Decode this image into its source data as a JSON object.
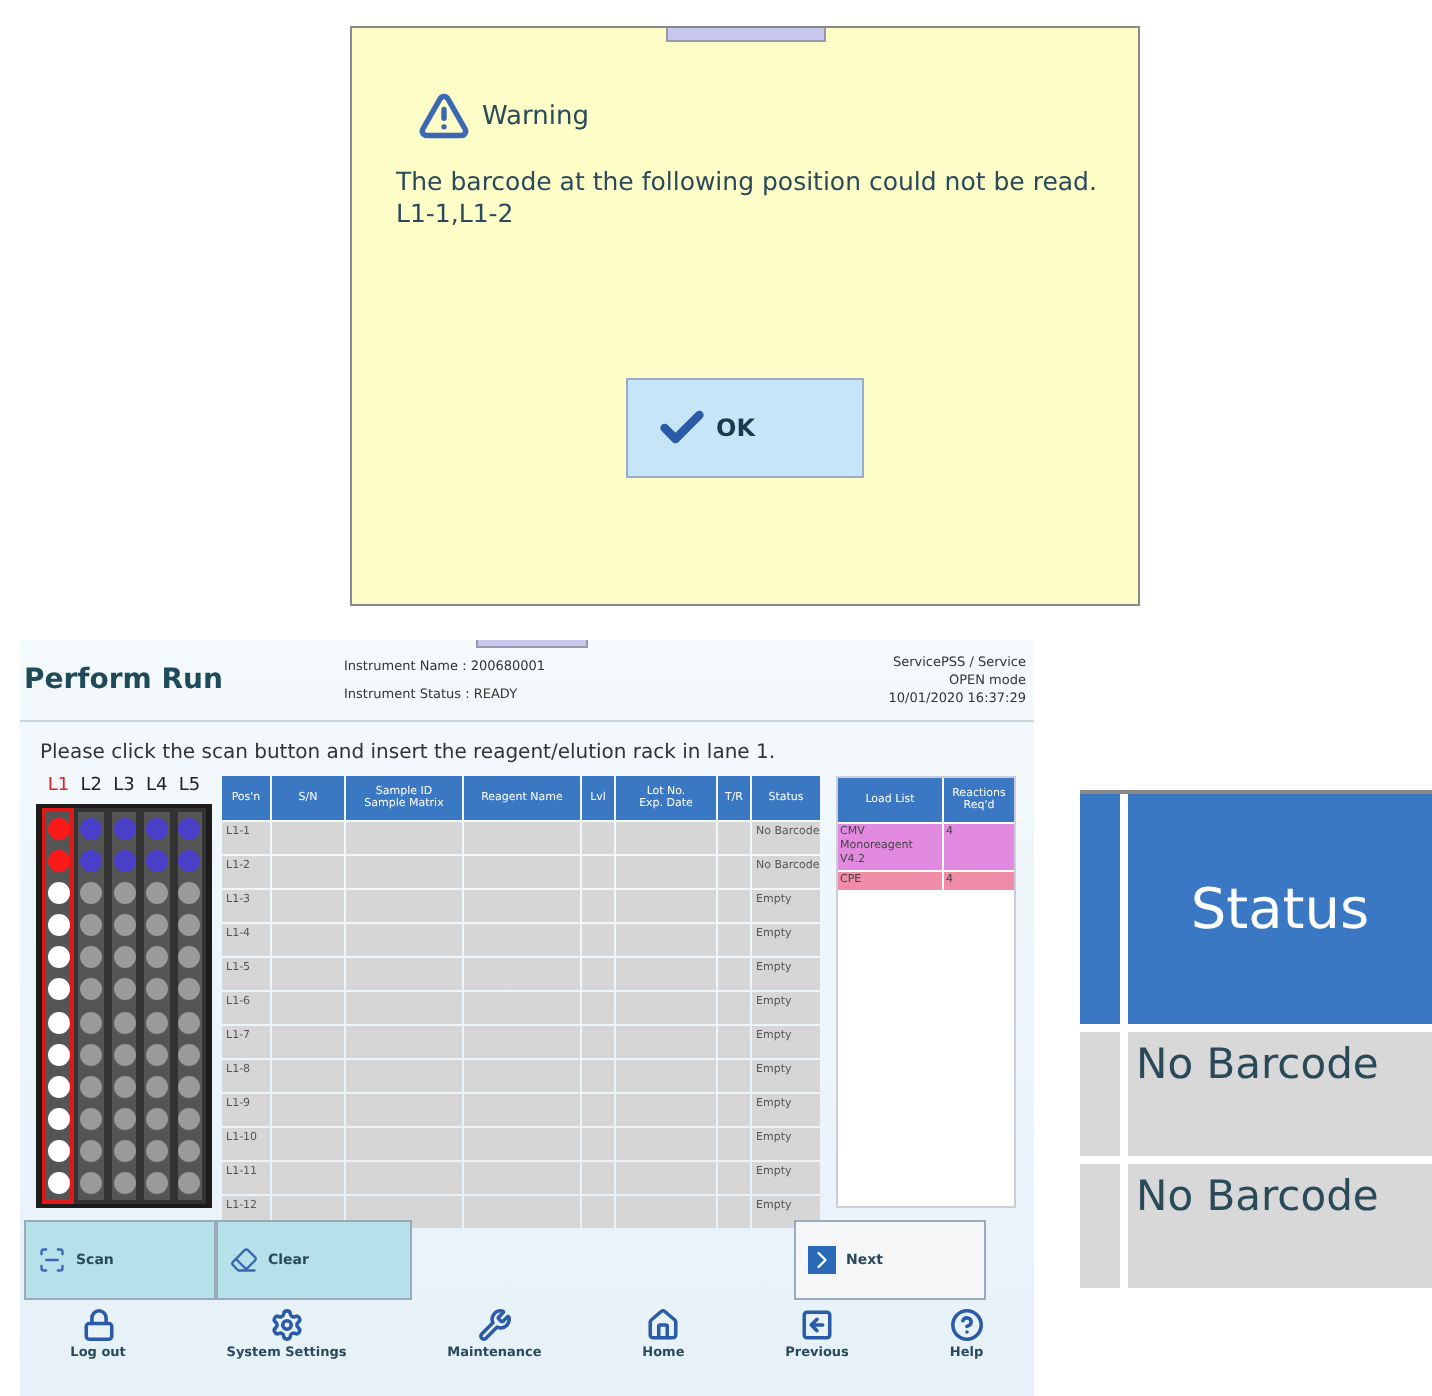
{
  "dialog": {
    "title": "Warning",
    "message": "The barcode at the following position could not be read.",
    "positions": "L1-1,L1-2",
    "button": "OK"
  },
  "screen": {
    "title": "Perform Run",
    "instrument_name": "Instrument Name : 200680001",
    "instrument_status": "Instrument Status : READY",
    "user": "ServicePSS / Service",
    "mode": "OPEN mode",
    "datetime": "10/01/2020 16:37:29",
    "instruction": "Please click the scan button and insert the reagent/elution rack in lane 1.",
    "lanes": [
      {
        "label": "L1",
        "selected": true,
        "wells": [
          {
            "kind": "error"
          },
          {
            "kind": "error"
          },
          {
            "kind": "empty"
          },
          {
            "kind": "empty"
          },
          {
            "kind": "empty"
          },
          {
            "kind": "empty"
          },
          {
            "kind": "empty"
          },
          {
            "kind": "empty"
          },
          {
            "kind": "empty"
          },
          {
            "kind": "empty"
          },
          {
            "kind": "empty"
          },
          {
            "kind": "empty"
          }
        ]
      },
      {
        "label": "L2",
        "selected": false,
        "wells": [
          {
            "kind": "loaded"
          },
          {
            "kind": "loaded"
          },
          {
            "kind": "empty"
          },
          {
            "kind": "empty"
          },
          {
            "kind": "empty"
          },
          {
            "kind": "empty"
          },
          {
            "kind": "empty"
          },
          {
            "kind": "empty"
          },
          {
            "kind": "empty"
          },
          {
            "kind": "empty"
          },
          {
            "kind": "empty"
          },
          {
            "kind": "empty"
          }
        ]
      },
      {
        "label": "L3",
        "selected": false,
        "wells": [
          {
            "kind": "loaded"
          },
          {
            "kind": "loaded"
          },
          {
            "kind": "empty"
          },
          {
            "kind": "empty"
          },
          {
            "kind": "empty"
          },
          {
            "kind": "empty"
          },
          {
            "kind": "empty"
          },
          {
            "kind": "empty"
          },
          {
            "kind": "empty"
          },
          {
            "kind": "empty"
          },
          {
            "kind": "empty"
          },
          {
            "kind": "empty"
          }
        ]
      },
      {
        "label": "L4",
        "selected": false,
        "wells": [
          {
            "kind": "loaded"
          },
          {
            "kind": "loaded"
          },
          {
            "kind": "empty"
          },
          {
            "kind": "empty"
          },
          {
            "kind": "empty"
          },
          {
            "kind": "empty"
          },
          {
            "kind": "empty"
          },
          {
            "kind": "empty"
          },
          {
            "kind": "empty"
          },
          {
            "kind": "empty"
          },
          {
            "kind": "empty"
          },
          {
            "kind": "empty"
          }
        ]
      },
      {
        "label": "L5",
        "selected": false,
        "wells": [
          {
            "kind": "loaded"
          },
          {
            "kind": "loaded"
          },
          {
            "kind": "empty"
          },
          {
            "kind": "empty"
          },
          {
            "kind": "empty"
          },
          {
            "kind": "empty"
          },
          {
            "kind": "empty"
          },
          {
            "kind": "empty"
          },
          {
            "kind": "empty"
          },
          {
            "kind": "empty"
          },
          {
            "kind": "empty"
          },
          {
            "kind": "empty"
          }
        ]
      }
    ],
    "table": {
      "columns": [
        [
          "Pos'n"
        ],
        [
          "S/N"
        ],
        [
          "Sample ID",
          "Sample Matrix"
        ],
        [
          "Reagent Name"
        ],
        [
          "Lvl"
        ],
        [
          "Lot No.",
          "Exp. Date"
        ],
        [
          "T/R"
        ],
        [
          "Status"
        ]
      ],
      "rows": [
        {
          "position": "L1-1",
          "status": "No Barcode"
        },
        {
          "position": "L1-2",
          "status": "No Barcode"
        },
        {
          "position": "L1-3",
          "status": "Empty"
        },
        {
          "position": "L1-4",
          "status": "Empty"
        },
        {
          "position": "L1-5",
          "status": "Empty"
        },
        {
          "position": "L1-6",
          "status": "Empty"
        },
        {
          "position": "L1-7",
          "status": "Empty"
        },
        {
          "position": "L1-8",
          "status": "Empty"
        },
        {
          "position": "L1-9",
          "status": "Empty"
        },
        {
          "position": "L1-10",
          "status": "Empty"
        },
        {
          "position": "L1-11",
          "status": "Empty"
        },
        {
          "position": "L1-12",
          "status": "Empty"
        }
      ]
    },
    "load_list": {
      "columns": [
        [
          "Load List"
        ],
        [
          "Reactions",
          "Req'd"
        ]
      ],
      "rows": [
        {
          "name": "CMV Monoreagent V4.2",
          "reactions": "4",
          "color": "#e28ae0"
        },
        {
          "name": "CPE",
          "reactions": "4",
          "color": "#f08ca8"
        }
      ]
    },
    "buttons": [
      {
        "kind": "scan",
        "label": "Scan"
      },
      {
        "kind": "clear",
        "label": "Clear"
      },
      {
        "kind": "next",
        "label": "Next"
      }
    ],
    "nav": [
      {
        "kind": "logout",
        "label": "Log out"
      },
      {
        "kind": "settings",
        "label": "System Settings"
      },
      {
        "kind": "maintenance",
        "label": "Maintenance"
      },
      {
        "kind": "home",
        "label": "Home"
      },
      {
        "kind": "previous",
        "label": "Previous"
      },
      {
        "kind": "help",
        "label": "Help"
      }
    ]
  },
  "inset": {
    "header": "Status",
    "cells": [
      "No Barcode",
      "No Barcode"
    ]
  }
}
